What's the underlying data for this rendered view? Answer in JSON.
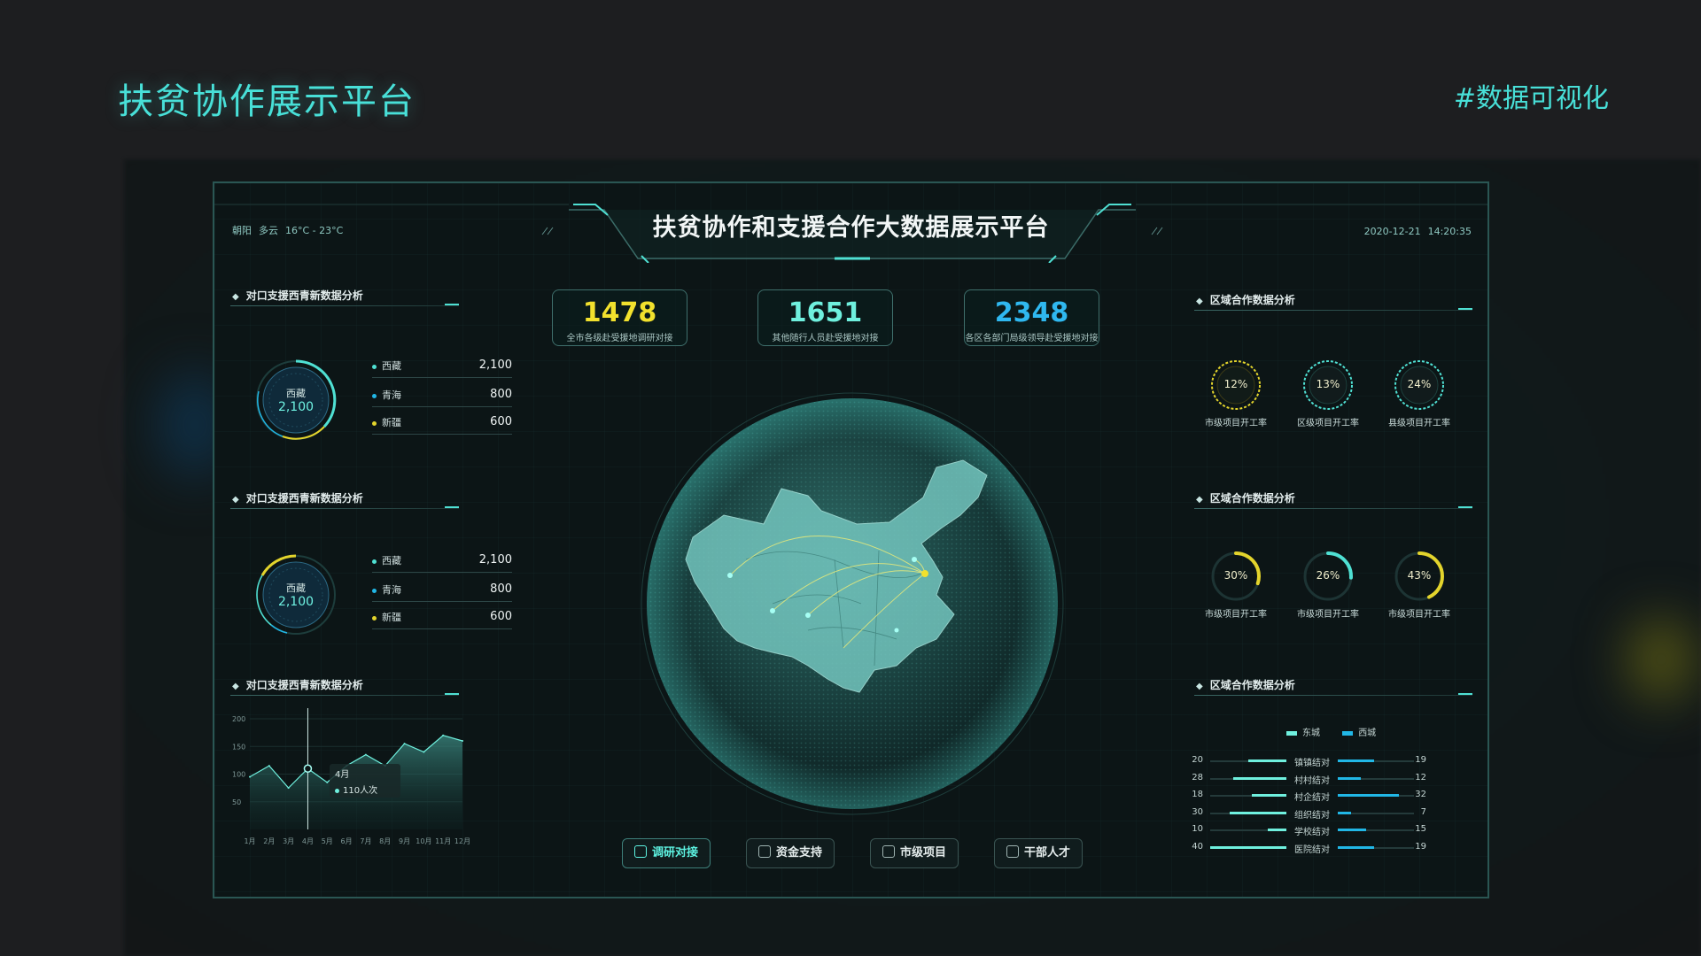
{
  "page": {
    "title": "扶贫协作展示平台",
    "tag": "#数据可视化"
  },
  "header": {
    "location": "朝阳",
    "weather": "多云",
    "temperature": "16°C - 23°C",
    "title": "扶贫协作和支援合作大数据展示平台",
    "date": "2020-12-21",
    "time": "14:20:35"
  },
  "left": {
    "panel1": {
      "title": "对口支援西青新数据分析",
      "center_label": "西藏",
      "center_value": "2,100",
      "legend": [
        {
          "name": "西藏",
          "value": "2,100",
          "color": "#4fe0d3"
        },
        {
          "name": "青海",
          "value": "800",
          "color": "#21b7e6"
        },
        {
          "name": "新疆",
          "value": "600",
          "color": "#e3d42c"
        }
      ]
    },
    "panel2": {
      "title": "对口支援西青新数据分析",
      "center_label": "西藏",
      "center_value": "2,100",
      "legend": [
        {
          "name": "西藏",
          "value": "2,100",
          "color": "#4fe0d3"
        },
        {
          "name": "青海",
          "value": "800",
          "color": "#21b7e6"
        },
        {
          "name": "新疆",
          "value": "600",
          "color": "#e3d42c"
        }
      ]
    },
    "panel3": {
      "title": "对口支援西青新数据分析",
      "tooltip_month": "4月",
      "tooltip_value": "110人次"
    }
  },
  "stats": [
    {
      "value": "1478",
      "label": "全市各级赴受援地调研对接",
      "color": "#f2e12d"
    },
    {
      "value": "1651",
      "label": "其他随行人员赴受援地对接",
      "color": "#6ff0de"
    },
    {
      "value": "2348",
      "label": "各区各部门局级领导赴受援地对接",
      "color": "#2fb8f0"
    }
  ],
  "right": {
    "panel1": {
      "title": "区域合作数据分析",
      "rings": [
        {
          "pct": "12%",
          "caption": "市级项目开工率",
          "color": "#e3d42c"
        },
        {
          "pct": "13%",
          "caption": "区级项目开工率",
          "color": "#4fe0d3"
        },
        {
          "pct": "24%",
          "caption": "县级项目开工率",
          "color": "#4fe0d3"
        }
      ]
    },
    "panel2": {
      "title": "区域合作数据分析",
      "rings": [
        {
          "pct": "30%",
          "value": 0.3,
          "caption": "市级项目开工率",
          "color": "#e3d42c"
        },
        {
          "pct": "26%",
          "value": 0.26,
          "caption": "市级项目开工率",
          "color": "#4fe0d3"
        },
        {
          "pct": "43%",
          "value": 0.43,
          "caption": "市级项目开工率",
          "color": "#e3d42c"
        }
      ]
    },
    "panel3": {
      "title": "区域合作数据分析",
      "legend": [
        {
          "name": "东城",
          "color": "#6ff0de"
        },
        {
          "name": "西城",
          "color": "#21b7e6"
        }
      ],
      "rows": [
        {
          "name": "镇镇结对",
          "left": 20,
          "right": 19
        },
        {
          "name": "村村结对",
          "left": 28,
          "right": 12
        },
        {
          "name": "村企结对",
          "left": 18,
          "right": 32
        },
        {
          "name": "组织结对",
          "left": 30,
          "right": 7
        },
        {
          "name": "学校结对",
          "left": 10,
          "right": 15
        },
        {
          "name": "医院结对",
          "left": 40,
          "right": 19
        }
      ]
    }
  },
  "nav": [
    {
      "label": "调研对接",
      "icon": "research-icon",
      "active": true
    },
    {
      "label": "资金支持",
      "icon": "funds-icon",
      "active": false
    },
    {
      "label": "市级项目",
      "icon": "project-icon",
      "active": false
    },
    {
      "label": "干部人才",
      "icon": "talent-icon",
      "active": false
    }
  ],
  "chart_data": {
    "type": "area",
    "categories": [
      "1月",
      "2月",
      "3月",
      "4月",
      "5月",
      "6月",
      "7月",
      "8月",
      "9月",
      "10月",
      "11月",
      "12月"
    ],
    "values": [
      95,
      115,
      75,
      110,
      85,
      115,
      135,
      115,
      155,
      140,
      170,
      160
    ],
    "ylim": [
      0,
      200
    ],
    "yticks": [
      "50",
      "100",
      "150",
      "200"
    ],
    "color": "#6ff0de"
  }
}
